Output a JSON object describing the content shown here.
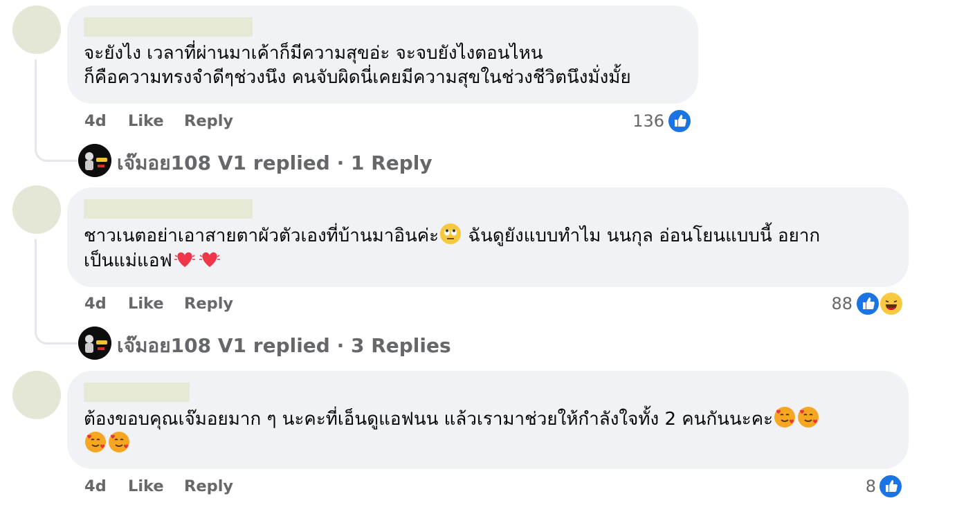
{
  "comments": [
    {
      "text_lines": [
        "จะยังไง เวลาที่ผ่านมาเค้าก็มีความสุขอ่ะ จะจบยังไงตอนไหน",
        "ก็คือความทรงจำดีๆช่วงนึง คนจับผิดนี่เคยมีความสุขในช่วงชีวิตนึงมั่งมั้ย"
      ],
      "time": "4d",
      "like": "Like",
      "reply": "Reply",
      "reaction_count": "136",
      "reactions": [
        "like-icon"
      ],
      "replies_summary": {
        "author": "เจ๊มอย108 V1",
        "action": "replied",
        "sep": "·",
        "count_text": "1 Reply"
      }
    },
    {
      "text_lines": [
        "ชาวเนตอย่าเอาสายตาผัวตัวเองที่บ้านมาอินค่ะ",
        " ฉันดูยังแบบทำไม นนกุล อ่อนโยนแบบนี้ อยาก",
        "เป็นแม่แอฟ"
      ],
      "time": "4d",
      "like": "Like",
      "reply": "Reply",
      "reaction_count": "88",
      "reactions": [
        "like-icon",
        "haha-icon"
      ],
      "replies_summary": {
        "author": "เจ๊มอย108 V1",
        "action": "replied",
        "sep": "·",
        "count_text": "3 Replies"
      }
    },
    {
      "text_lines": [
        "ต้องขอบคุณเจ๊มอยมาก ๆ นะคะที่เอ็นดูแอฟนน แล้วเรามาช่วยให้กำลังใจทั้ง 2 คนกันนะคะ"
      ],
      "time": "4d",
      "like": "Like",
      "reply": "Reply",
      "reaction_count": "8",
      "reactions": [
        "like-icon"
      ]
    }
  ],
  "colors": {
    "like": "#1b74e4",
    "bubble": "#f0f2f5",
    "meta": "#65676b",
    "redaction": "#e7e9d7"
  }
}
